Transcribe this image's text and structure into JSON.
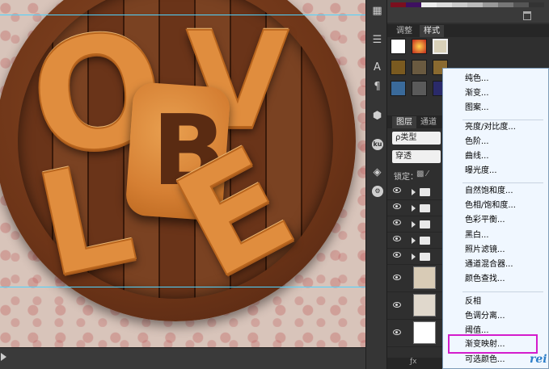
{
  "canvas": {
    "letters": [
      "O",
      "V",
      "B",
      "L",
      "E"
    ],
    "guide_color": "#4fd4ff"
  },
  "toolstrip": {
    "icons": [
      "swatches-icon",
      "sliders-icon",
      "text-tool-icon",
      "paragraph-icon",
      "3d-cube-icon",
      "ku-icon",
      "cube-grid-icon",
      "gear-icon"
    ],
    "ku_label": "ku"
  },
  "panels": {
    "adjust_tab": "调整",
    "styles_tab": "样式",
    "layers_tab": "图层",
    "channels_tab": "通道",
    "filter_label": "ρ类型",
    "blend_mode": "穿透",
    "lock_label": "锁定：",
    "footer": "ƒx"
  },
  "menu": {
    "items": [
      {
        "label": "纯色..."
      },
      {
        "label": "渐变..."
      },
      {
        "label": "图案..."
      },
      {
        "label": "亮度/对比度..."
      },
      {
        "label": "色阶..."
      },
      {
        "label": "曲线..."
      },
      {
        "label": "曝光度..."
      },
      {
        "label": "自然饱和度..."
      },
      {
        "label": "色相/饱和度..."
      },
      {
        "label": "色彩平衡..."
      },
      {
        "label": "黑白..."
      },
      {
        "label": "照片滤镜..."
      },
      {
        "label": "通道混合器..."
      },
      {
        "label": "颜色查找..."
      },
      {
        "label": "反相"
      },
      {
        "label": "色调分离..."
      },
      {
        "label": "阈值..."
      },
      {
        "label": "渐变映射..."
      },
      {
        "label": "可选颜色..."
      }
    ],
    "highlighted": "渐变映射...",
    "highlight_color": "#d41ccc"
  },
  "watermark": "rei"
}
